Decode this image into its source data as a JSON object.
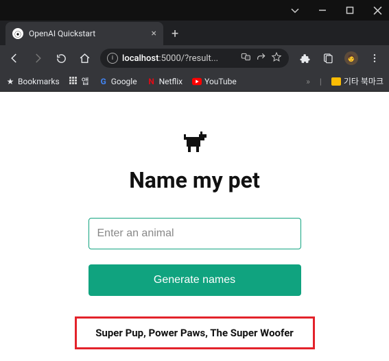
{
  "window": {
    "tab_title": "OpenAI Quickstart"
  },
  "toolbar": {
    "url_host": "localhost",
    "url_port": ":5000",
    "url_path": "/?result..."
  },
  "bookmarks": {
    "bookmarks_label": "Bookmarks",
    "apps_label": "앱",
    "google": "Google",
    "netflix": "Netflix",
    "youtube": "YouTube",
    "other_folder": "기타 북마크"
  },
  "page": {
    "title": "Name my pet",
    "input_placeholder": "Enter an animal",
    "button_label": "Generate names",
    "result": "Super Pup, Power Paws, The Super Woofer"
  }
}
